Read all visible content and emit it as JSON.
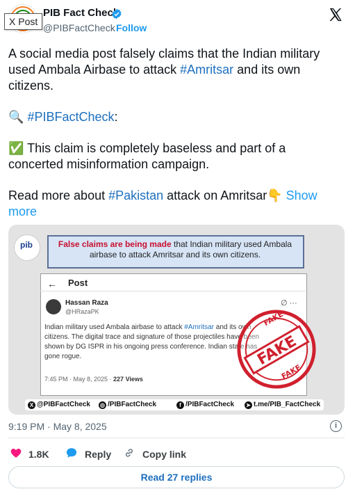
{
  "tooltip": "X Post",
  "author": {
    "name": "PIB Fact Check",
    "handle": "@PIBFactCheck",
    "separator": "·",
    "follow_label": "Follow"
  },
  "post": {
    "para1_pre": "A social media post falsely claims that the Indian military used Ambala Airbase to attack ",
    "para1_tag": "#Amritsar",
    "para1_post": " and its own citizens.",
    "para2_emoji": "🔍",
    "para2_tag": "#PIBFactCheck",
    "para2_post": ":",
    "para3_emoji": "✅",
    "para3_text": " This claim is completely baseless and part of a concerted misinformation  campaign.",
    "para4_pre": "Read more about ",
    "para4_tag": "#Pakistan",
    "para4_post": " attack on Amritsar",
    "para4_emoji": "👇",
    "show_more": "Show more"
  },
  "media": {
    "logo_text": "pib",
    "banner_red": "False claims are being made",
    "banner_rest": " that Indian military used Ambala airbase to attack Amritsar and its own citizens.",
    "inner": {
      "back": "←",
      "title": "Post",
      "name": "Hassan Raza",
      "handle": "@HRazaPK",
      "icons": "∅  ···",
      "text_pre": "Indian military used Ambala airbase to attack ",
      "text_tag": "#Amritsar",
      "text_rest": " and its own citizens. The digital trace and signature of those projectiles have been shown by DG ISPR in his ongoing press conference. Indian state has gone rogue.",
      "time": "7:45 PM · May 8, 2025 · ",
      "views": "227 Views"
    },
    "stamp_text": "FAKE",
    "stamp_ring": "FAKE",
    "footer": [
      "@PIBFactCheck",
      "/PIBFactCheck",
      "/PIBFactCheck",
      "t.me/PIB_FactCheck"
    ]
  },
  "meta": {
    "timestamp": "9:19 PM · May 8, 2025",
    "info": "i"
  },
  "actions": {
    "likes": "1.8K",
    "reply": "Reply",
    "copy_link": "Copy link",
    "read_replies": "Read 27 replies"
  },
  "colors": {
    "link": "#1d6fbf",
    "accent": "#1d9bf0",
    "heart": "#f91880",
    "stamp": "#d0202e"
  }
}
